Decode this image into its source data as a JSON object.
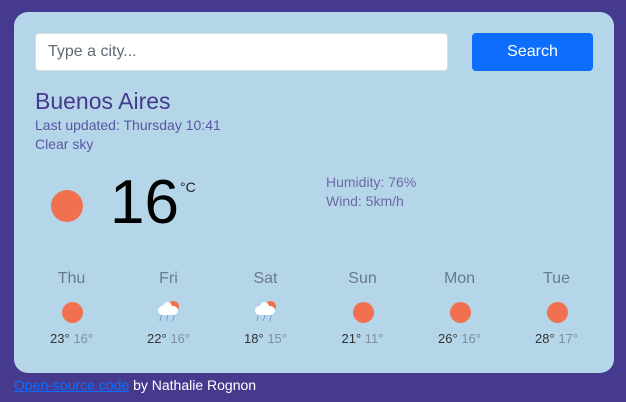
{
  "search": {
    "placeholder": "Type a city...",
    "value": "",
    "button_label": "Search"
  },
  "current": {
    "city": "Buenos Aires",
    "last_updated": "Last updated: Thursday 10:41",
    "condition": "Clear sky",
    "icon": "sun-icon",
    "temperature": "16",
    "unit": "°C",
    "humidity": "Humidity: 76%",
    "wind": "Wind: 5km/h"
  },
  "forecast": [
    {
      "day": "Thu",
      "icon": "sun-icon",
      "max": "23°",
      "min": "16°"
    },
    {
      "day": "Fri",
      "icon": "rain-icon",
      "max": "22°",
      "min": "16°"
    },
    {
      "day": "Sat",
      "icon": "rain-icon",
      "max": "18°",
      "min": "15°"
    },
    {
      "day": "Sun",
      "icon": "sun-icon",
      "max": "21°",
      "min": "11°"
    },
    {
      "day": "Mon",
      "icon": "sun-icon",
      "max": "26°",
      "min": "16°"
    },
    {
      "day": "Tue",
      "icon": "sun-icon",
      "max": "28°",
      "min": "17°"
    }
  ],
  "footer": {
    "link_text": "Open-source code",
    "suffix": " by Nathalie Rognon"
  },
  "colors": {
    "background": "#463a8e",
    "card": "#b5d6e8",
    "accent": "#0d6efd",
    "sun": "#f07050",
    "city": "#433a8c"
  }
}
